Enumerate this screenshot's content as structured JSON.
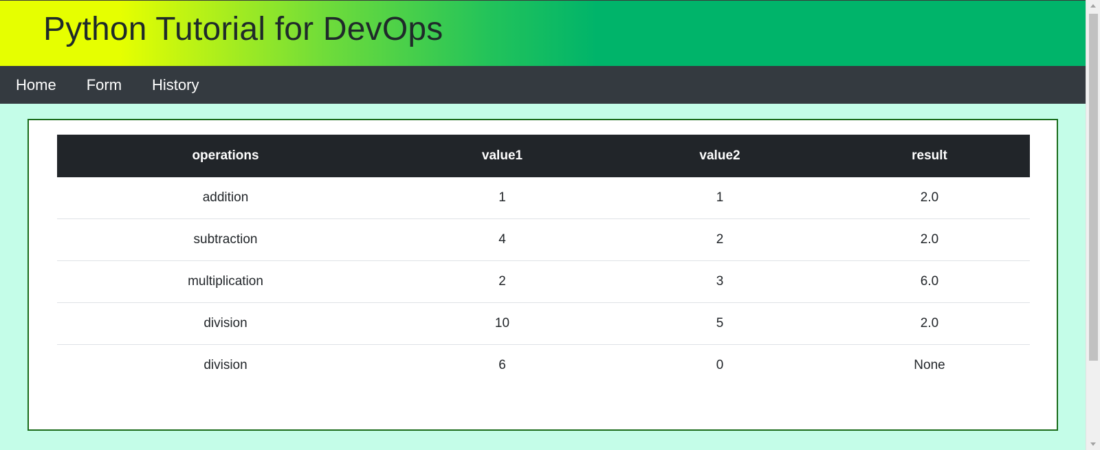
{
  "header": {
    "title": "Python Tutorial for DevOps"
  },
  "nav": {
    "items": [
      {
        "label": "Home"
      },
      {
        "label": "Form"
      },
      {
        "label": "History"
      }
    ]
  },
  "table": {
    "columns": [
      "operations",
      "value1",
      "value2",
      "result"
    ],
    "rows": [
      [
        "addition",
        "1",
        "1",
        "2.0"
      ],
      [
        "subtraction",
        "4",
        "2",
        "2.0"
      ],
      [
        "multiplication",
        "2",
        "3",
        "6.0"
      ],
      [
        "division",
        "10",
        "5",
        "2.0"
      ],
      [
        "division",
        "6",
        "0",
        "None"
      ]
    ]
  },
  "colors": {
    "header_gradient_start": "#e6ff00",
    "header_gradient_end": "#00b46a",
    "navbar": "#343a40",
    "page_background": "#c4fde8",
    "table_header": "#212529",
    "box_border": "#1a6b1a"
  }
}
